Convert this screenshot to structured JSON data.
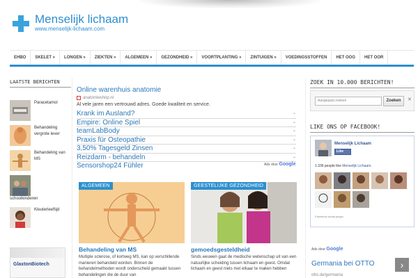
{
  "header": {
    "title": "Menselijk lichaam",
    "url": "www.menselijk-lichaam.com",
    "logo_icon": "medical-cross-icon",
    "accent_color": "#2c8fcf"
  },
  "nav": {
    "items": [
      "EHBO",
      "SKELET »",
      "LONGEN »",
      "ZIEKTEN »",
      "ALGEMEEN »",
      "GEZONDHEID »",
      "VOORTPLANTING »",
      "ZINTUIGEN »",
      "VOEDINGSSTOFFEN",
      "HET OOG",
      "HET OOR"
    ]
  },
  "left": {
    "heading": "LAATSTE BERICHTEN",
    "recent": [
      {
        "label": "Paracetamol"
      },
      {
        "label": "Behandeling vergrote lever"
      },
      {
        "label": "Behandeling van MS"
      },
      {
        "label": "schoolkinderen"
      },
      {
        "label": "Kleuterleeftijd"
      }
    ],
    "sponsor": "GlaxtonBiotech"
  },
  "ads": {
    "main_title": "Online warenhuis anatomie",
    "main_url": "anatomieshop.nl",
    "main_desc": "Al vele jaren een vertrouwd adres. Goede kwaliteit en service.",
    "links": [
      "Krank im Ausland?",
      "Empire: Online Spiel",
      "teamLabBody",
      "Praxis für Osteopathie",
      "3,50% Tagesgeld Zinsen",
      "Reizdarm - behandeln",
      "Sensorshop24 Fühler"
    ],
    "ads_by": "Ads door",
    "google": "Google"
  },
  "articles": [
    {
      "category": "ALGEMEEN",
      "title": "Behandeling van MS",
      "text": "Multiple sclerose, of kortweg MS, kan op verschillende manieren behandeld worden. Binnen de behandelmethoden wordt onderscheid gemaakt tussen behandelingen die de duur van"
    },
    {
      "category": "GEESTELIJKE GEZONDHEID",
      "title": "gemoedsgesteldheid",
      "text": "Sinds eeuwen gaat de medische wetenschap uit van een natuurlijke scheiding tussen lichaam en geest. Omdat lichaam en geest niets met elkaar te maken hebben"
    }
  ],
  "right": {
    "search_heading": "ZOEK IN 10.000 BERICHTEN!",
    "search_placeholder": "Aangepast zoeken",
    "search_button": "Zoeken",
    "fb_heading": "LIKE ONS OP FACEBOOK!",
    "fb_page_name": "Menselijk Lichaam",
    "fb_like": "Like",
    "fb_count": "1.336 people like",
    "fb_count_link": "Menselijk Lichaam.",
    "fb_plugin": "Facebook social plugin",
    "ads_by": "Ads door",
    "google": "Google",
    "ad_title": "Germania bei OTTO",
    "ad_url": "otto.de/germania"
  }
}
